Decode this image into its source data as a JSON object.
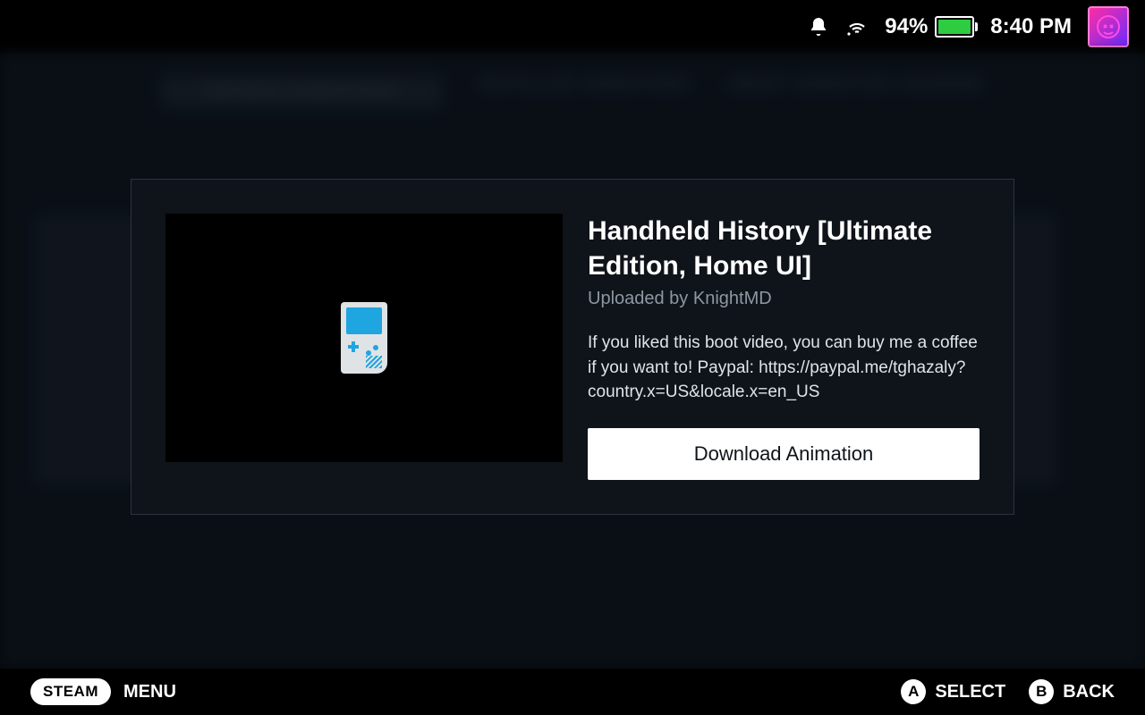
{
  "status": {
    "battery_percent": "94%",
    "battery_fill_pct": 94,
    "time": "8:40 PM"
  },
  "bg_tabs": {
    "t1": "BROWSE ANIMATIONS",
    "t2": "INSTALLED ANIMATIONS",
    "t3": "ABOUT ANIMATION CHANGER"
  },
  "modal": {
    "title": "Handheld History [Ultimate Edition, Home UI]",
    "uploaded_by": "Uploaded by KnightMD",
    "description": "If you liked this boot video, you can buy me a coffee if you want to! Paypal: https://paypal.me/tghazaly?country.x=US&locale.x=en_US",
    "download_label": "Download Animation"
  },
  "footer": {
    "steam": "STEAM",
    "menu": "MENU",
    "a_glyph": "A",
    "a_label": "SELECT",
    "b_glyph": "B",
    "b_label": "BACK"
  }
}
